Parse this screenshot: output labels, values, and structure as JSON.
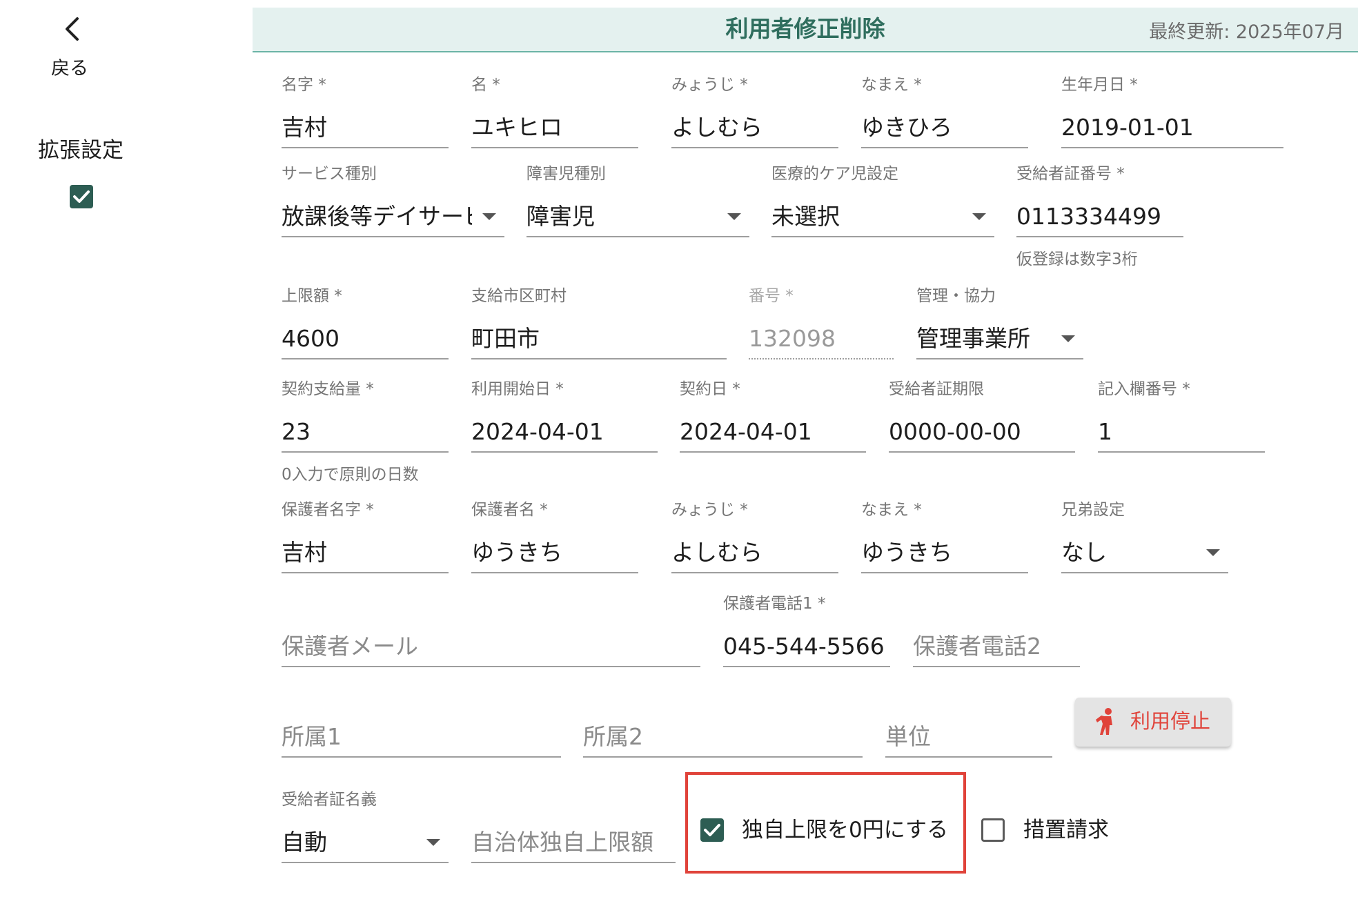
{
  "sidebar": {
    "back_label": "戻る",
    "extended_settings_label": "拡張設定",
    "extended_settings_checked": true
  },
  "header": {
    "title": "利用者修正削除",
    "updated_label": "最終更新: 2025年07月"
  },
  "row1": {
    "last_name": {
      "label": "名字 *",
      "value": "吉村"
    },
    "first_name": {
      "label": "名 *",
      "value": "ユキヒロ"
    },
    "last_name_kana": {
      "label": "みょうじ *",
      "value": "よしむら"
    },
    "first_name_kana": {
      "label": "なまえ *",
      "value": "ゆきひろ"
    },
    "birthdate": {
      "label": "生年月日 *",
      "value": "2019-01-01"
    }
  },
  "row2": {
    "service_type": {
      "label": "サービス種別",
      "value": "放課後等デイサービス"
    },
    "disability_type": {
      "label": "障害児種別",
      "value": "障害児"
    },
    "medical_care": {
      "label": "医療的ケア児設定",
      "value": "未選択"
    },
    "recipient_number": {
      "label": "受給者証番号 *",
      "value": "0113334499",
      "helper": "仮登録は数字3桁"
    }
  },
  "row3": {
    "upper_limit": {
      "label": "上限額 *",
      "value": "4600"
    },
    "municipality": {
      "label": "支給市区町村",
      "value": "町田市"
    },
    "number": {
      "label": "番号 *",
      "value": "132098"
    },
    "management": {
      "label": "管理・協力",
      "value": "管理事業所"
    }
  },
  "row4": {
    "contract_amount": {
      "label": "契約支給量 *",
      "value": "23",
      "helper": "0入力で原則の日数"
    },
    "start_date": {
      "label": "利用開始日 *",
      "value": "2024-04-01"
    },
    "contract_date": {
      "label": "契約日 *",
      "value": "2024-04-01"
    },
    "certificate_expiry": {
      "label": "受給者証期限",
      "value": "0000-00-00"
    },
    "entry_number": {
      "label": "記入欄番号 *",
      "value": "1"
    }
  },
  "row5": {
    "guardian_last_name": {
      "label": "保護者名字 *",
      "value": "吉村"
    },
    "guardian_first_name": {
      "label": "保護者名 *",
      "value": "ゆうきち"
    },
    "guardian_last_kana": {
      "label": "みょうじ *",
      "value": "よしむら"
    },
    "guardian_first_kana": {
      "label": "なまえ *",
      "value": "ゆうきち"
    },
    "sibling": {
      "label": "兄弟設定",
      "value": "なし"
    }
  },
  "row6": {
    "guardian_email": {
      "placeholder": "保護者メール"
    },
    "guardian_phone1": {
      "label": "保護者電話1 *",
      "value": "045-544-5566"
    },
    "guardian_phone2": {
      "placeholder": "保護者電話2"
    }
  },
  "row7": {
    "affiliation1": {
      "placeholder": "所属1"
    },
    "affiliation2": {
      "placeholder": "所属2"
    },
    "unit": {
      "placeholder": "単位"
    },
    "stop_button_label": "利用停止"
  },
  "row8": {
    "certificate_name": {
      "label": "受給者証名義",
      "value": "自動"
    },
    "municipal_limit": {
      "placeholder": "自治体独自上限額"
    },
    "zero_limit": {
      "label": "独自上限を0円にする",
      "checked": true
    },
    "measure_billing": {
      "label": "措置請求",
      "checked": false
    }
  },
  "colors": {
    "accent": "#2d5d53",
    "header_bg": "#e4f1ef",
    "danger": "#e0433a"
  }
}
